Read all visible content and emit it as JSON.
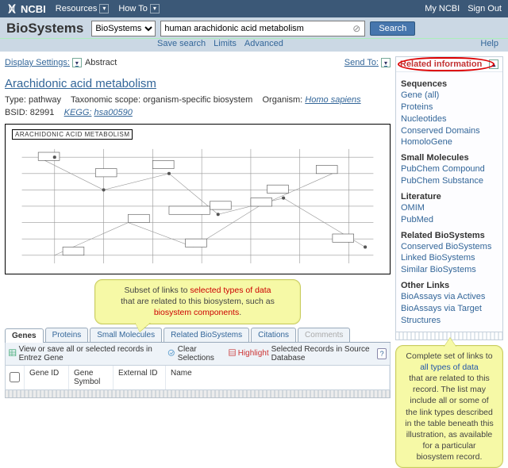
{
  "topbar": {
    "logo": "NCBI",
    "resources": "Resources",
    "howto": "How To",
    "my": "My NCBI",
    "signout": "Sign Out"
  },
  "search": {
    "brand": "BioSystems",
    "db_selected": "BioSystems",
    "query": "human arachidonic acid metabolism",
    "button": "Search",
    "save": "Save search",
    "limits": "Limits",
    "advanced": "Advanced",
    "help": "Help"
  },
  "meta": {
    "display_settings": "Display Settings:",
    "view": "Abstract",
    "send_to": "Send To:"
  },
  "record": {
    "title": "Arachidonic acid metabolism",
    "type_label": "Type:",
    "type_value": "pathway",
    "scope_label": "Taxonomic scope:",
    "scope_value": "organism-specific biosystem",
    "organism_label": "Organism:",
    "organism_link": "Homo sapiens",
    "bsid_label": "BSID:",
    "bsid_value": "82991",
    "kegg_label": "KEGG:",
    "kegg_link": " hsa00590",
    "diagram_title": "ARACHIDONIC ACID METABOLISM"
  },
  "callouts": {
    "left_pre": "Subset of links to ",
    "left_hl": "selected types of data",
    "left_mid": " that are related to this biosystem, such as ",
    "left_hl2": "biosystem components",
    "left_post": ".",
    "right_pre": "Complete set of links to ",
    "right_hl": "all types of data",
    "right_post": " that are related to this record. The list may include all or some of the link types described in the table beneath this illustration, as available for a particular biosystem record."
  },
  "tabs": {
    "items": [
      "Genes",
      "Proteins",
      "Small Molecules",
      "Related BioSystems",
      "Citations",
      "Comments"
    ],
    "active_index": 0
  },
  "tablebar": {
    "view": "View or save all or selected records in Entrez Gene",
    "clear": "Clear Selections",
    "highlight": "Highlight",
    "highlight_rest": " Selected Records in Source Database"
  },
  "columns": [
    "Gene ID",
    "Gene Symbol",
    "External ID",
    "Name"
  ],
  "side": {
    "header": "Related information",
    "groups": [
      {
        "title": "Sequences",
        "links": [
          "Gene (all)",
          "Proteins",
          "Nucleotides",
          "Conserved Domains",
          "HomoloGene"
        ]
      },
      {
        "title": "Small Molecules",
        "links": [
          "PubChem Compound",
          "PubChem Substance"
        ]
      },
      {
        "title": "Literature",
        "links": [
          "OMIM",
          "PubMed"
        ]
      },
      {
        "title": "Related BioSystems",
        "links": [
          "Conserved BioSystems",
          "Linked BioSystems",
          "Similar BioSystems"
        ]
      },
      {
        "title": "Other Links",
        "links": [
          "BioAssays via Actives",
          "BioAssays via Target",
          "Structures"
        ]
      }
    ]
  }
}
